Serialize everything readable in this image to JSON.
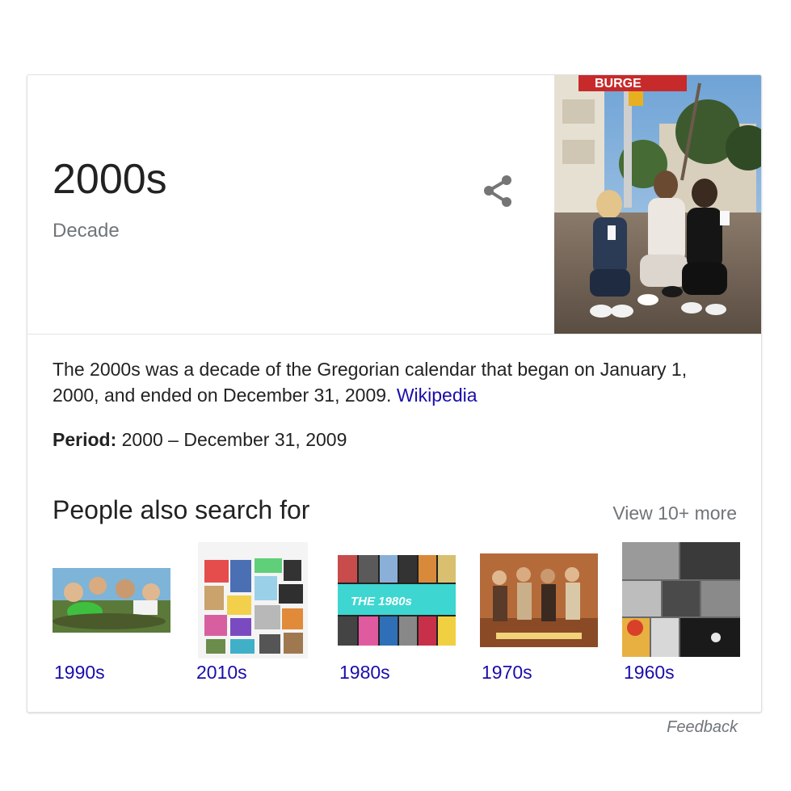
{
  "entity": {
    "title": "2000s",
    "subtitle": "Decade"
  },
  "share": {
    "icon": "share-icon"
  },
  "hero_image": {
    "sign_text": "BURGE"
  },
  "description": {
    "text": "The 2000s was a decade of the Gregorian calendar that began on January 1, 2000, and ended on December 31, 2009.",
    "source_label": "Wikipedia"
  },
  "facts": {
    "period_label": "Period:",
    "period_value": "2000 – December 31, 2009"
  },
  "people_also_search": {
    "title": "People also search for",
    "view_more": "View 10+ more",
    "items": [
      {
        "label": "1990s"
      },
      {
        "label": "2010s"
      },
      {
        "label": "1980s",
        "image_text": "THE 1980s"
      },
      {
        "label": "1970s"
      },
      {
        "label": "1960s"
      }
    ]
  },
  "feedback": "Feedback",
  "colors": {
    "link": "#1a0dab",
    "text": "#222222",
    "muted": "#70757a",
    "border": "#dfe1e5"
  }
}
